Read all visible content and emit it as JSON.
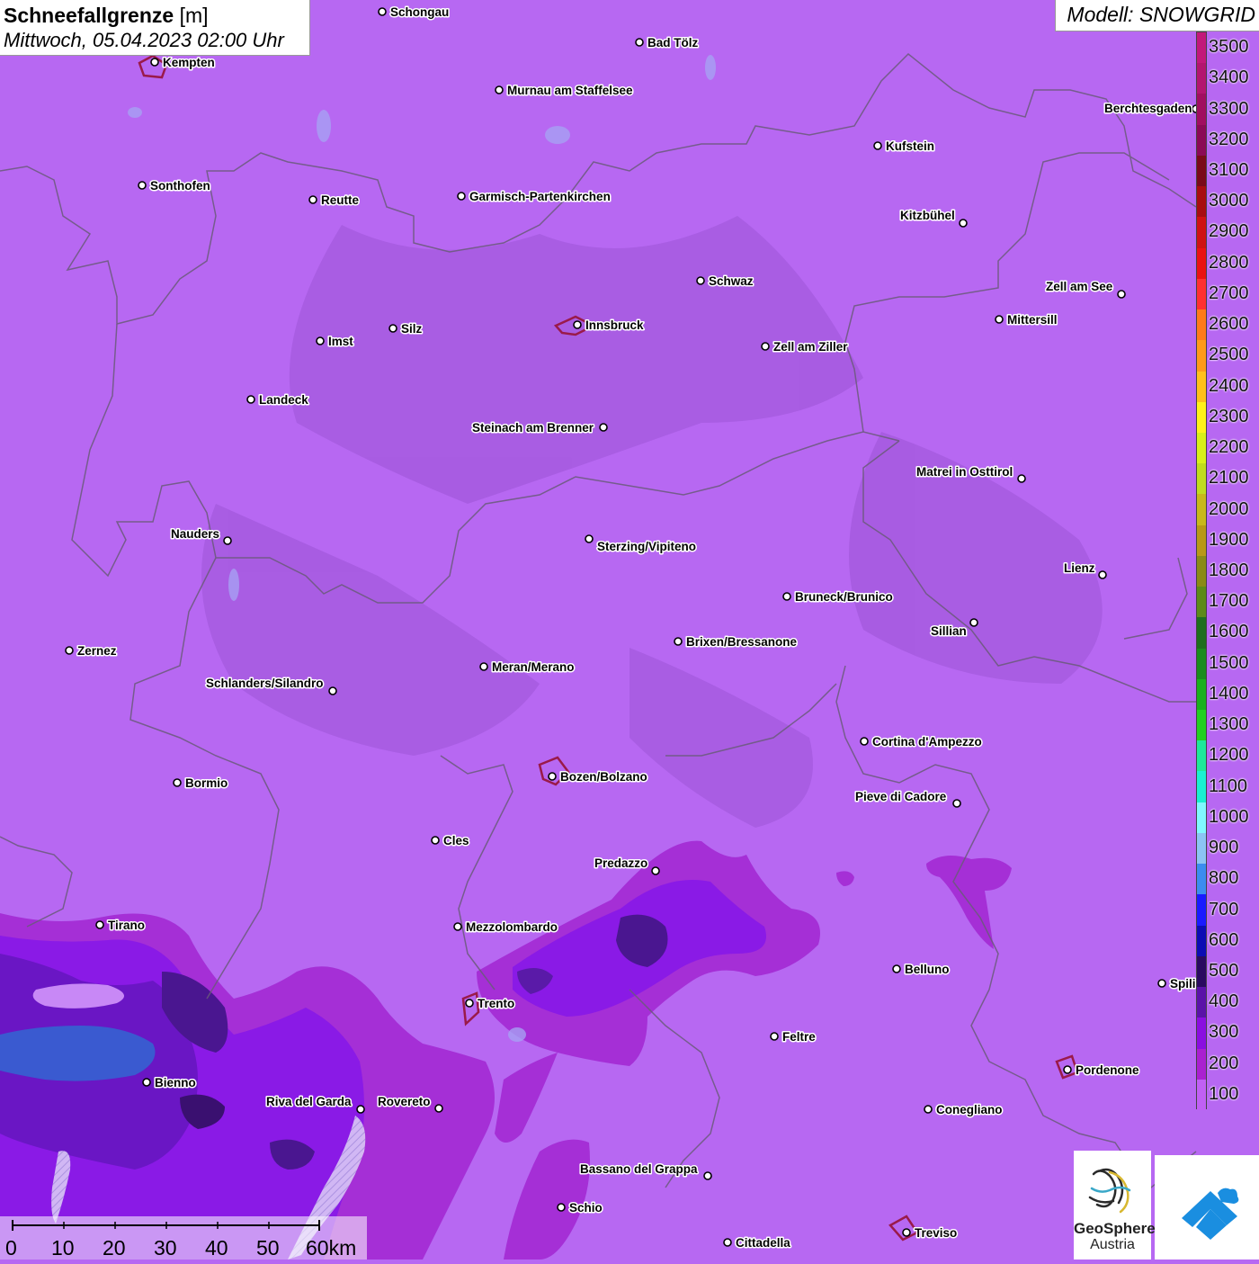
{
  "header": {
    "title_bold": "Schneefallgrenze",
    "title_unit": "[m]",
    "subtitle": "Mittwoch, 05.04.2023 02:00 Uhr",
    "model": "Modell: SNOWGRID"
  },
  "legend": {
    "levels": [
      {
        "value": "3500",
        "color": "#c2187a"
      },
      {
        "value": "3400",
        "color": "#b3156f"
      },
      {
        "value": "3300",
        "color": "#a10e60"
      },
      {
        "value": "3200",
        "color": "#8b0a56"
      },
      {
        "value": "3100",
        "color": "#7a0a1a"
      },
      {
        "value": "3000",
        "color": "#a80d10"
      },
      {
        "value": "2900",
        "color": "#cf1212"
      },
      {
        "value": "2800",
        "color": "#ea1212"
      },
      {
        "value": "2700",
        "color": "#ff3030"
      },
      {
        "value": "2600",
        "color": "#ff7a1a"
      },
      {
        "value": "2500",
        "color": "#ff9a18"
      },
      {
        "value": "2400",
        "color": "#ffc01a"
      },
      {
        "value": "2300",
        "color": "#fff21a"
      },
      {
        "value": "2200",
        "color": "#d8f01a"
      },
      {
        "value": "2100",
        "color": "#c0dc1e"
      },
      {
        "value": "2000",
        "color": "#c8b81a"
      },
      {
        "value": "1900",
        "color": "#b89816"
      },
      {
        "value": "1800",
        "color": "#8a8a16"
      },
      {
        "value": "1700",
        "color": "#5c8a18"
      },
      {
        "value": "1600",
        "color": "#1e6e1e"
      },
      {
        "value": "1500",
        "color": "#1a8c1e"
      },
      {
        "value": "1400",
        "color": "#1ab01e"
      },
      {
        "value": "1300",
        "color": "#22d022"
      },
      {
        "value": "1200",
        "color": "#1ee89a"
      },
      {
        "value": "1100",
        "color": "#1af0d2"
      },
      {
        "value": "1000",
        "color": "#80f8ff"
      },
      {
        "value": "900",
        "color": "#8cc4f4"
      },
      {
        "value": "800",
        "color": "#3c8cf0"
      },
      {
        "value": "700",
        "color": "#1a1aff"
      },
      {
        "value": "600",
        "color": "#0c0cb4"
      },
      {
        "value": "500",
        "color": "#2a0a60"
      },
      {
        "value": "400",
        "color": "#5a12a8"
      },
      {
        "value": "300",
        "color": "#8a0ee0"
      },
      {
        "value": "200",
        "color": "#aa20d0"
      },
      {
        "value": "100",
        "color": "#c060f4"
      }
    ]
  },
  "cities": [
    {
      "name": "Schongau"
    },
    {
      "name": "Kempten"
    },
    {
      "name": "Bad Tölz"
    },
    {
      "name": "Murnau am Staffelsee"
    },
    {
      "name": "Berchtesgaden"
    },
    {
      "name": "Kufstein"
    },
    {
      "name": "Sonthofen"
    },
    {
      "name": "Reutte"
    },
    {
      "name": "Garmisch-Partenkirchen"
    },
    {
      "name": "Kitzbühel"
    },
    {
      "name": "Schwaz"
    },
    {
      "name": "Zell am See"
    },
    {
      "name": "Innsbruck"
    },
    {
      "name": "Mittersill"
    },
    {
      "name": "Imst"
    },
    {
      "name": "Silz"
    },
    {
      "name": "Zell am Ziller"
    },
    {
      "name": "Landeck"
    },
    {
      "name": "Steinach am Brenner"
    },
    {
      "name": "Matrei in Osttirol"
    },
    {
      "name": "Nauders"
    },
    {
      "name": "Sterzing/Vipiteno"
    },
    {
      "name": "Lienz"
    },
    {
      "name": "Bruneck/Brunico"
    },
    {
      "name": "Sillian"
    },
    {
      "name": "Zernez"
    },
    {
      "name": "Brixen/Bressanone"
    },
    {
      "name": "Meran/Merano"
    },
    {
      "name": "Schlanders/Silandro"
    },
    {
      "name": "Cortina d'Ampezzo"
    },
    {
      "name": "Bormio"
    },
    {
      "name": "Bozen/Bolzano"
    },
    {
      "name": "Pieve di Cadore"
    },
    {
      "name": "Cles"
    },
    {
      "name": "Predazzo"
    },
    {
      "name": "Tirano"
    },
    {
      "name": "Mezzolombardo"
    },
    {
      "name": "Belluno"
    },
    {
      "name": "Spili"
    },
    {
      "name": "Trento"
    },
    {
      "name": "Feltre"
    },
    {
      "name": "Pordenone"
    },
    {
      "name": "Bienno"
    },
    {
      "name": "Riva del Garda"
    },
    {
      "name": "Rovereto"
    },
    {
      "name": "Conegliano"
    },
    {
      "name": "Bassano del Grappa"
    },
    {
      "name": "Schio"
    },
    {
      "name": "Treviso"
    },
    {
      "name": "Cittadella"
    }
  ],
  "scale_bar": {
    "ticks": [
      "0",
      "10",
      "20",
      "30",
      "40",
      "50",
      "60km"
    ]
  },
  "logos": {
    "geosphere_line1": "GeoSphere",
    "geosphere_line2": "Austria"
  }
}
